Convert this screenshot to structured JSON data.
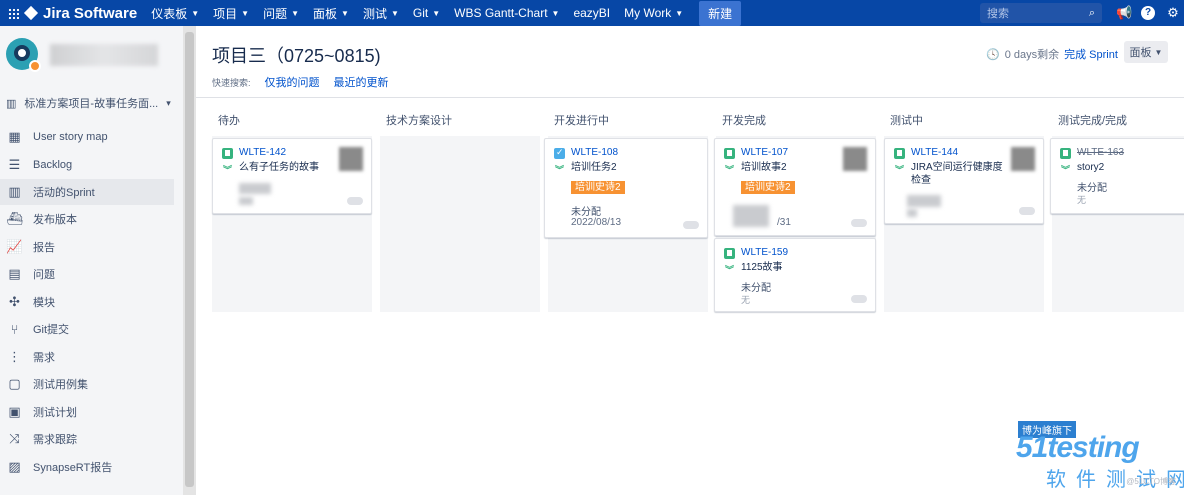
{
  "topbar": {
    "app_name": "Jira Software",
    "nav": [
      "仪表板",
      "项目",
      "问题",
      "面板",
      "测试",
      "Git",
      "WBS Gantt-Chart",
      "eazyBI",
      "My Work"
    ],
    "create_label": "新建",
    "search_placeholder": "搜索",
    "accent_color": "#0747a6"
  },
  "sidebar": {
    "board_selector": "标准方案项目-故事任务面...",
    "items": [
      {
        "label": "User story map",
        "icon": "map-icon"
      },
      {
        "label": "Backlog",
        "icon": "backlog-icon"
      },
      {
        "label": "活动的Sprint",
        "icon": "board-icon",
        "active": true
      },
      {
        "label": "发布版本",
        "icon": "ship-icon"
      },
      {
        "label": "报告",
        "icon": "chart-icon"
      },
      {
        "label": "问题",
        "icon": "issues-icon"
      },
      {
        "label": "模块",
        "icon": "puzzle-icon"
      },
      {
        "label": "Git提交",
        "icon": "git-icon"
      },
      {
        "label": "需求",
        "icon": "requirements-icon"
      },
      {
        "label": "测试用例集",
        "icon": "testcase-icon"
      },
      {
        "label": "测试计划",
        "icon": "testplan-icon"
      },
      {
        "label": "需求跟踪",
        "icon": "trace-icon"
      },
      {
        "label": "SynapseRT报告",
        "icon": "report-icon"
      }
    ]
  },
  "board": {
    "title": "项目三（0725~0815)",
    "quick_filter_label": "快速搜索:",
    "quick_filters": [
      "仅我的问题",
      "最近的更新"
    ],
    "days_left": "0 days剩余",
    "complete_sprint": "完成 Sprint",
    "board_menu": "面板",
    "columns": [
      {
        "name": "待办"
      },
      {
        "name": "技术方案设计"
      },
      {
        "name": "开发进行中"
      },
      {
        "name": "开发完成"
      },
      {
        "name": "测试中"
      },
      {
        "name": "测试完成/完成"
      }
    ],
    "cards": {
      "c142": {
        "key": "WLTE-142",
        "summary": "么有子任务的故事"
      },
      "c108": {
        "key": "WLTE-108",
        "summary": "培训任务2",
        "epic": "培训史诗2",
        "assignee": "未分配",
        "due": "2022/08/13"
      },
      "c107": {
        "key": "WLTE-107",
        "summary": "培训故事2",
        "epic": "培训史诗2",
        "due_partial": "/31"
      },
      "c159": {
        "key": "WLTE-159",
        "summary": "1125故事",
        "assignee": "未分配",
        "none": "无"
      },
      "c144": {
        "key": "WLTE-144",
        "summary_line1": "JIRA空间运行健康度",
        "summary_line2": "检查"
      },
      "c163": {
        "key": "WLTE-163",
        "summary": "story2",
        "assignee": "未分配",
        "none": "无"
      }
    }
  },
  "watermark": {
    "tag": "博为峰旗下",
    "brand": "51testing",
    "cn": "软件测试网",
    "small": "@51CTO博客"
  }
}
